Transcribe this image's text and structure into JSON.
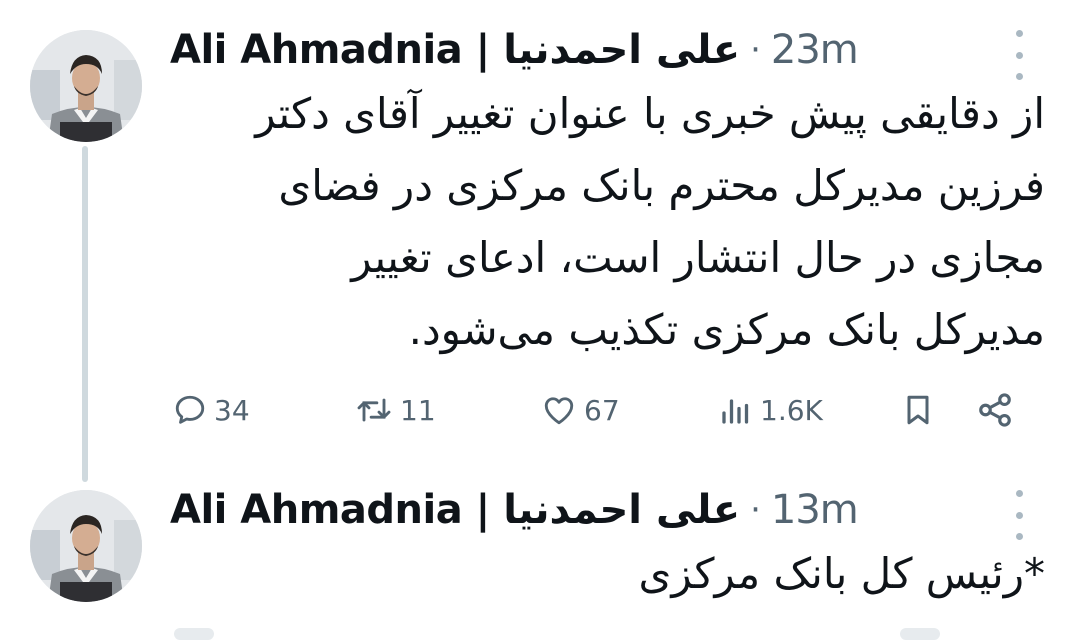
{
  "colors": {
    "text": "#0f1419",
    "muted": "#536471",
    "thread_line": "#cfd9de",
    "background": "#ffffff"
  },
  "tweets": [
    {
      "author": "Ali Ahmadnia | علی احمدنیا",
      "separator": "·",
      "time": "23m",
      "lines": [
        "از دقایقی پیش خبری با عنوان تغییر آقای دکتر",
        "فرزین مدیرکل محترم بانک مرکزی در فضای",
        "مجازی در حال انتشار است، ادعای تغییر",
        "مدیرکل بانک مرکزی تکذیب می‌شود."
      ],
      "actions": {
        "replies": "34",
        "reposts": "11",
        "likes": "67",
        "views": "1.6K"
      },
      "icons": [
        "reply-icon",
        "repost-icon",
        "like-icon",
        "views-icon",
        "bookmark-icon",
        "share-icon",
        "more-icon"
      ]
    },
    {
      "author": "Ali Ahmadnia | علی احمدنیا",
      "separator": "·",
      "time": "13m",
      "lines": [
        "*رئیس کل بانک مرکزی"
      ],
      "icons": [
        "more-icon"
      ]
    }
  ]
}
